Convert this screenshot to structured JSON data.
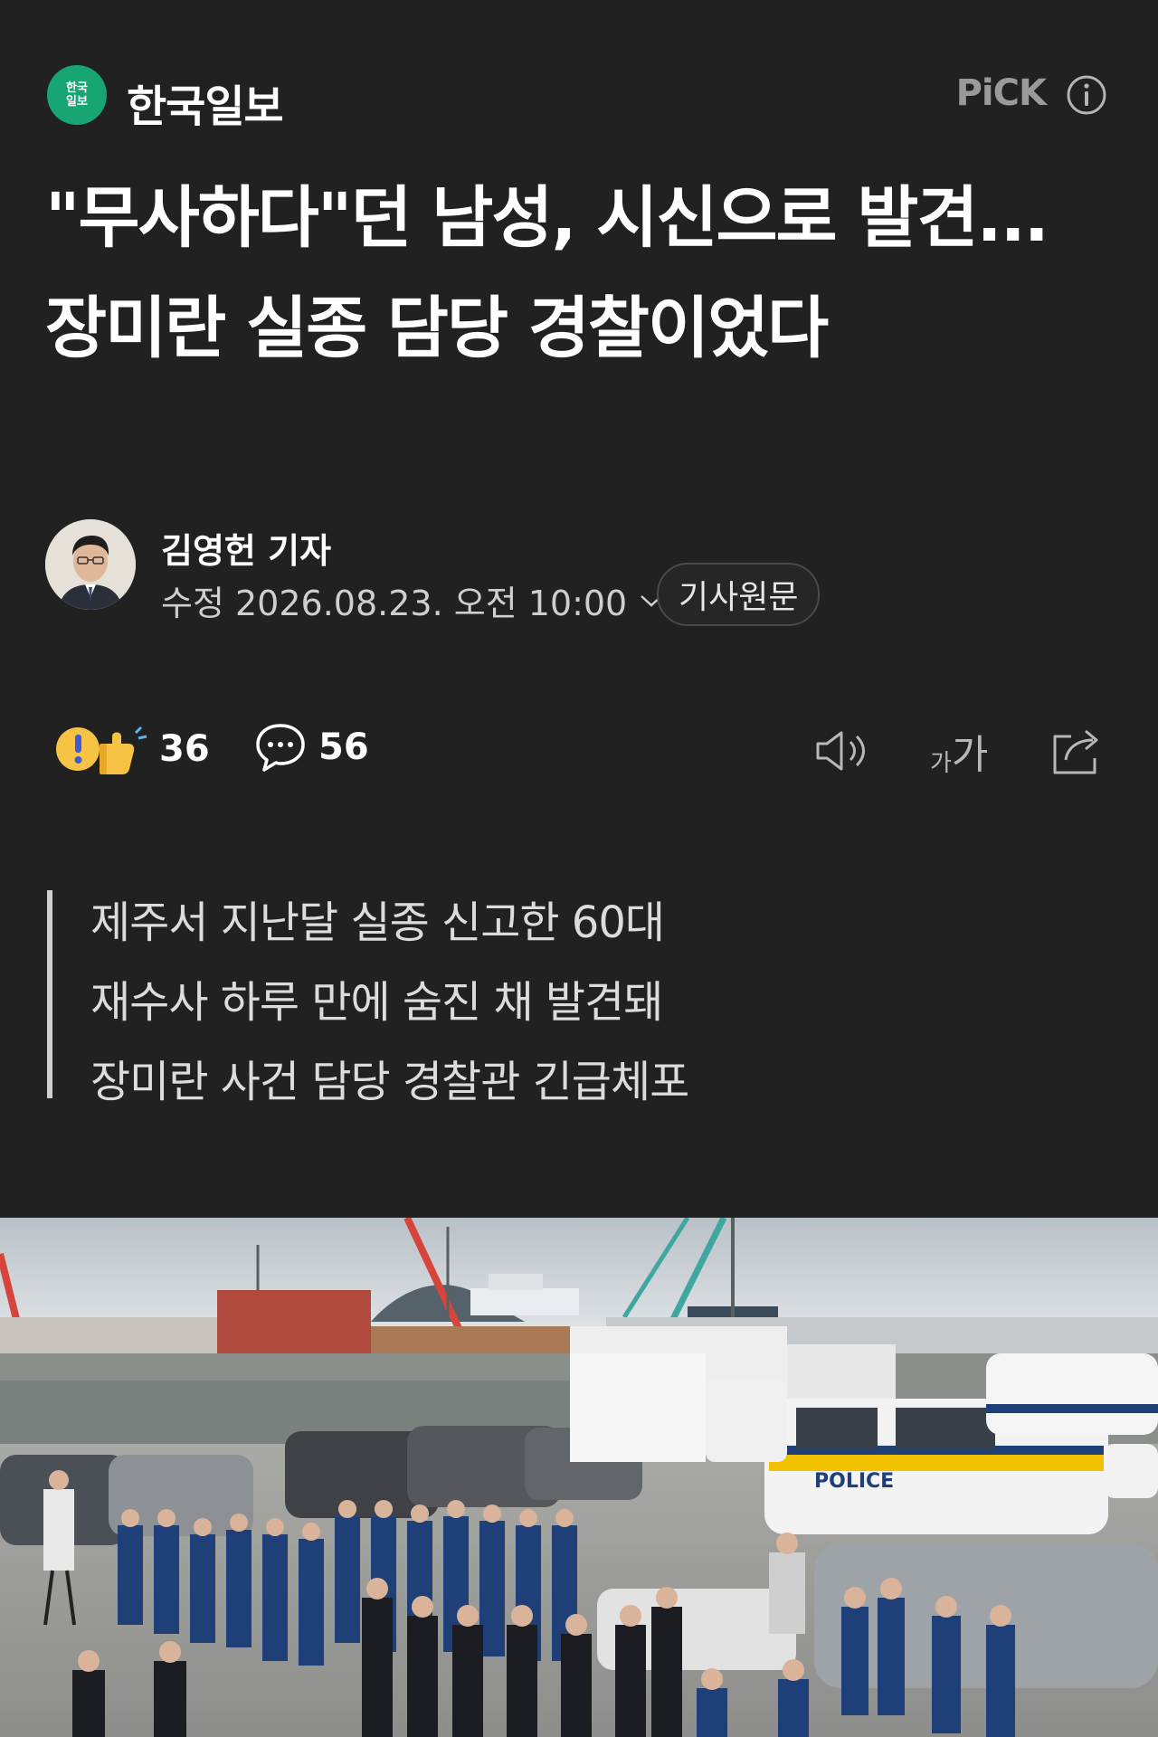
{
  "header": {
    "logo_badge_text": "한국\n일보",
    "brand_name": "한국일보",
    "pick_label": "PiCK",
    "info_icon": "info-circle-icon"
  },
  "article": {
    "headline": "\"무사하다\"던 남성, 시신으로 발견... 장미란 실종 담당 경찰이었다",
    "author": "김영헌 기자",
    "date_label": "수정 2026.08.23. 오전 10:00",
    "original_button": "기사원문"
  },
  "actions": {
    "reaction_count": "36",
    "comment_count": "56",
    "icons": [
      "reaction-icon",
      "comment-icon",
      "audio-icon",
      "font-size-icon",
      "share-icon"
    ],
    "font_size_label_small": "가",
    "font_size_label_large": "가"
  },
  "summary": {
    "lines": [
      "제주서 지난달 실종 신고한 60대",
      "재수사 하루 만에 숨진 채 발견돼",
      "장미란 사건 담당 경찰관 긴급체포"
    ]
  },
  "photo": {
    "van_text": "POLICE",
    "colors": {
      "police_blue": "#1e3f78",
      "van_stripe_yellow": "#f2c200",
      "sky": "#c9d0d6"
    }
  },
  "theme": {
    "background": "#212122",
    "logo_green": "#17a574",
    "muted_gray": "#9a9a9a"
  }
}
